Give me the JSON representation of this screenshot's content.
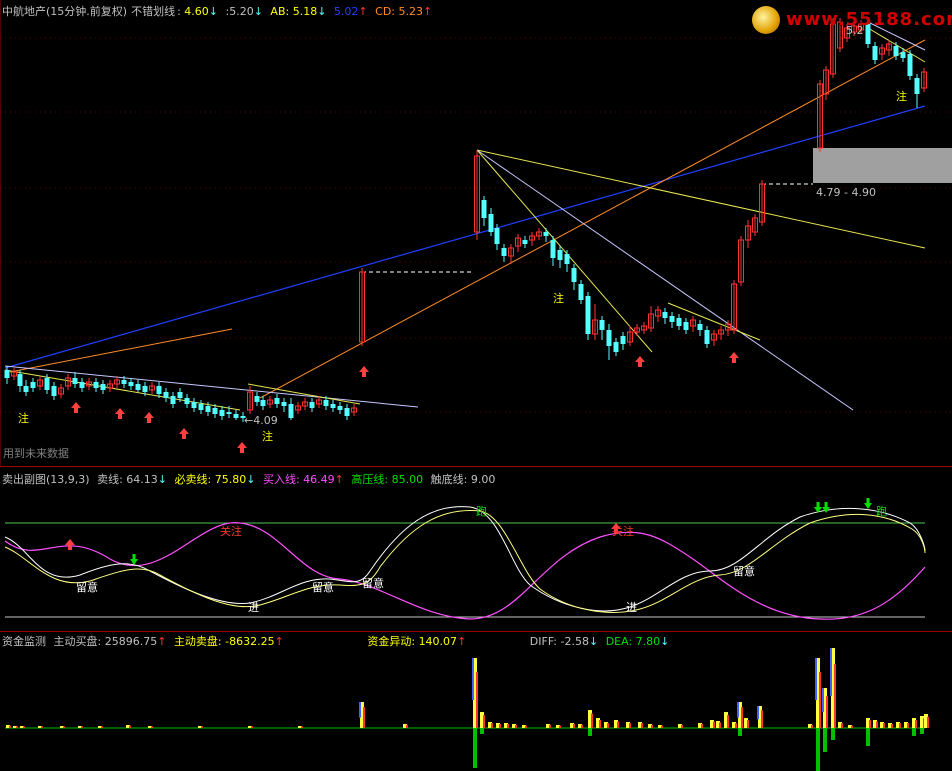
{
  "main": {
    "title": "中航地产(15分钟.前复权)",
    "indicator_name": "不错划线",
    "v1": "4.60",
    "v2": ":5.20",
    "ab_label": "AB:",
    "ab_value": "5.18",
    "v3": "5.02",
    "cd_label": "CD:",
    "cd_value": "5.23",
    "price_low": "4.09",
    "price_high": "5.2",
    "range_label": "4.79 - 4.90",
    "footnote": "用到未来数据",
    "zhu_label": "注",
    "watermark": "www.55188.com"
  },
  "sub": {
    "title": "卖出副图(13,9,3)",
    "sell_label": "卖线:",
    "sell_value": "64.13",
    "must_sell_label": "必卖线:",
    "must_sell_value": "75.80",
    "buy_label": "买入线:",
    "buy_value": "46.49",
    "high_label": "高压线:",
    "high_value": "85.00",
    "low_label": "触底线:",
    "low_value": "9.00",
    "attention": "关注",
    "watch": "留意",
    "enter": "进",
    "run": "跑"
  },
  "fund": {
    "title": "资金监测",
    "buy_label": "主动买盘:",
    "buy_value": "25896.75",
    "sell_label": "主动卖盘:",
    "sell_value": "-8632.25",
    "abn_label": "资金异动:",
    "abn_value": "140.07",
    "diff_label": "DIFF:",
    "diff_value": "-2.58",
    "dea_label": "DEA:",
    "dea_value": "7.80"
  },
  "colors": {
    "up": "#ff3232",
    "down": "#54ffff",
    "blue_line": "#2040ff",
    "orange_line": "#ff8c28",
    "yellow_line": "#e6e650",
    "white_line": "#c8c8ff",
    "magenta": "#ff50ff",
    "green": "#00c000",
    "sep": "#a00000"
  }
}
